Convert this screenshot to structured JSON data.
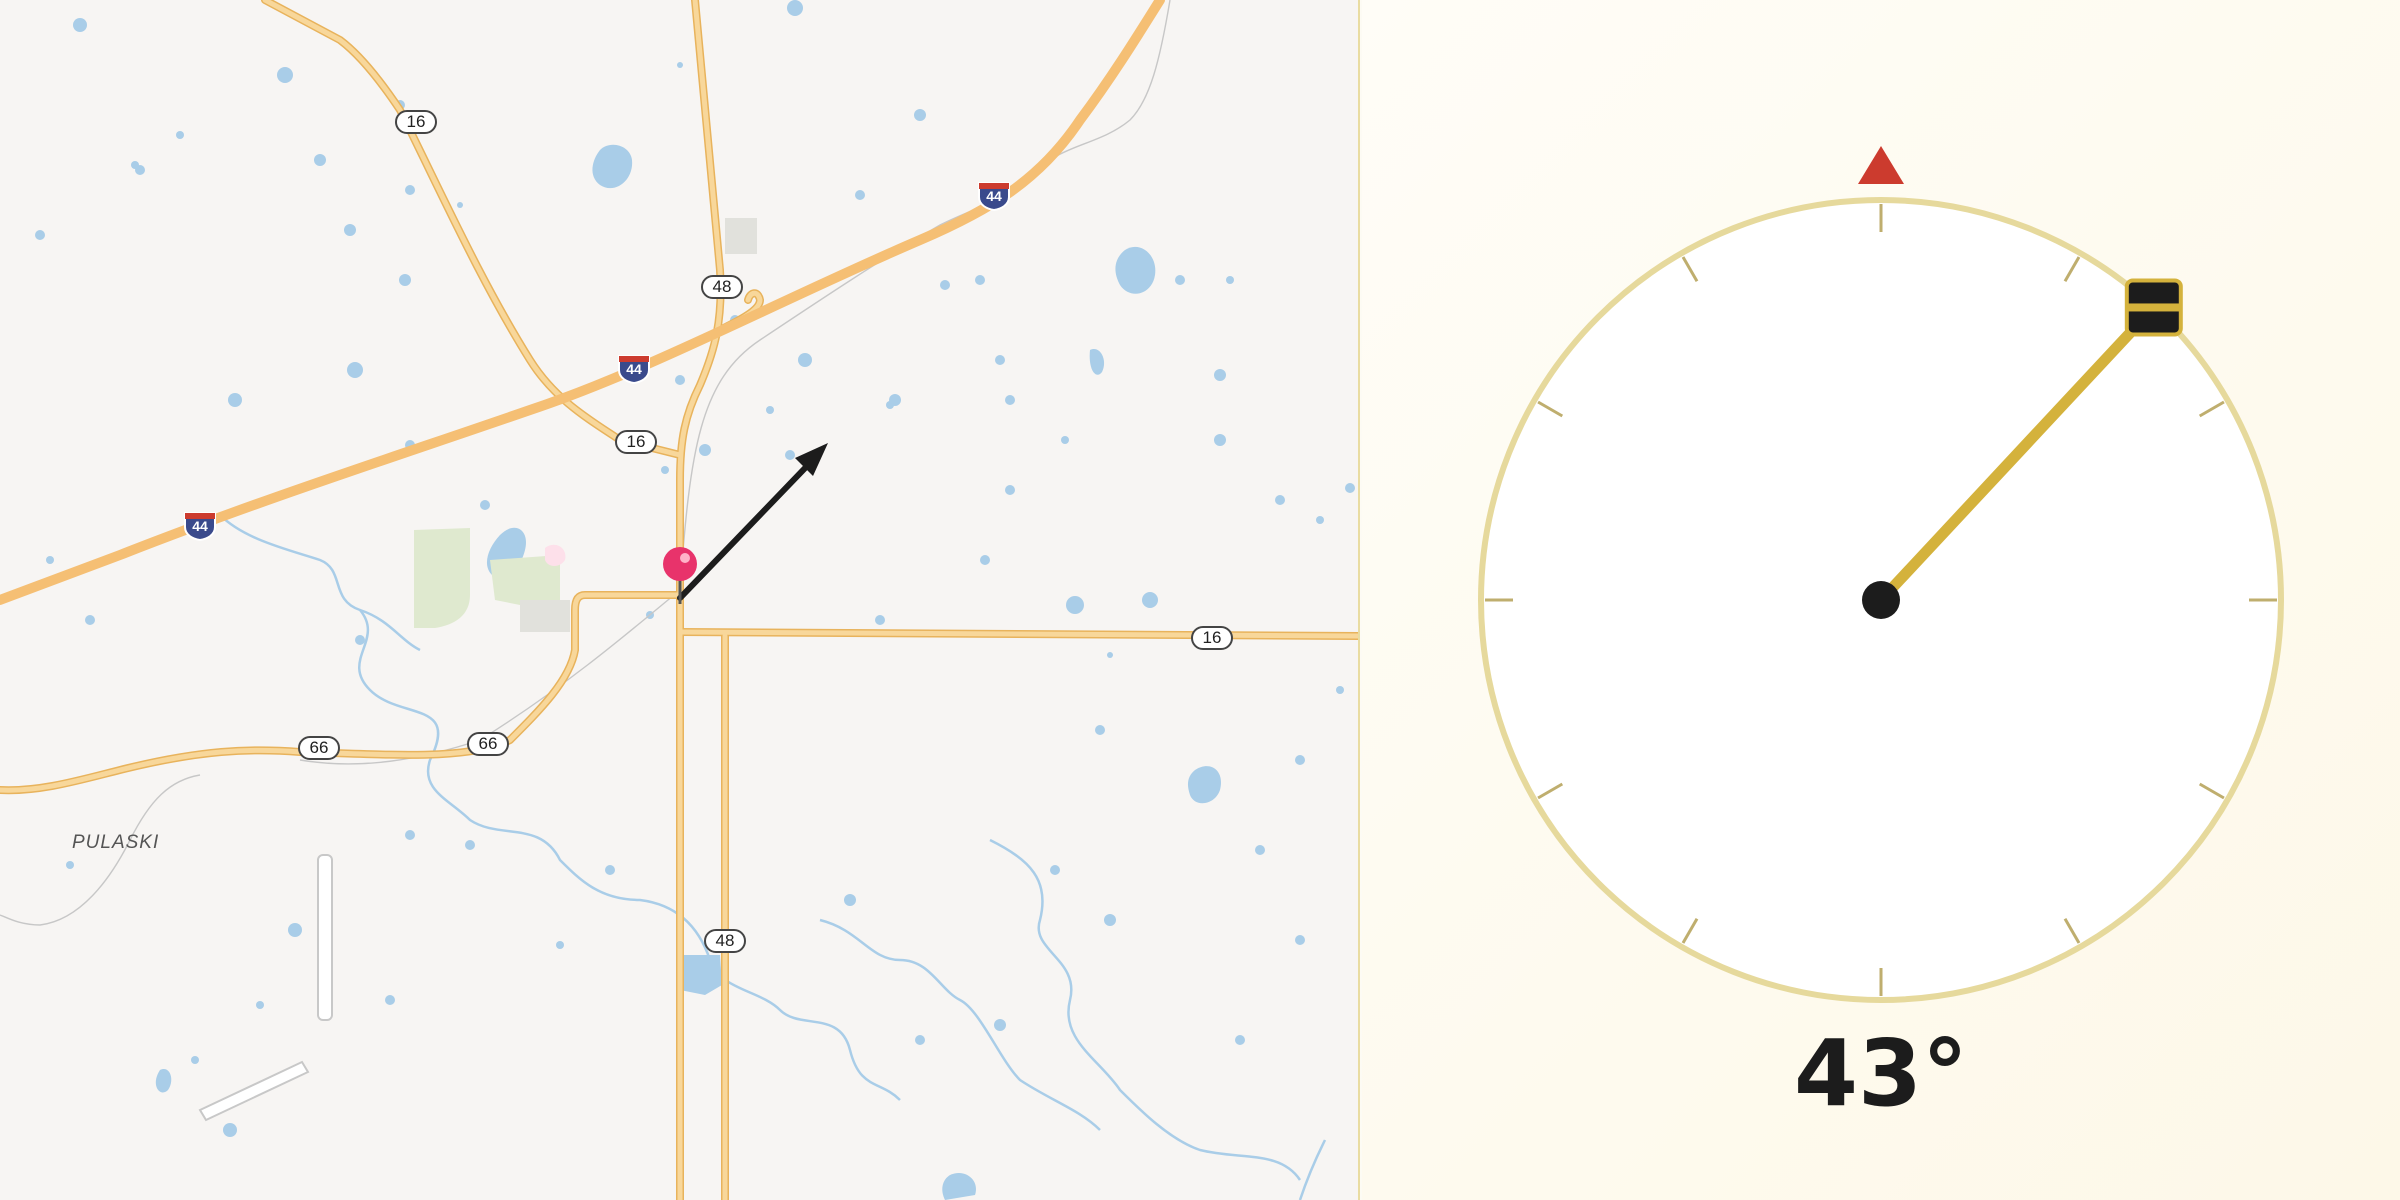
{
  "map": {
    "route_shields": [
      {
        "kind": "state",
        "label": "16"
      },
      {
        "kind": "state",
        "label": "48"
      },
      {
        "kind": "state",
        "label": "16"
      },
      {
        "kind": "state",
        "label": "16"
      },
      {
        "kind": "state",
        "label": "66"
      },
      {
        "kind": "state",
        "label": "66"
      },
      {
        "kind": "state",
        "label": "48"
      },
      {
        "kind": "interstate",
        "label": "44"
      },
      {
        "kind": "interstate",
        "label": "44"
      },
      {
        "kind": "interstate",
        "label": "44"
      }
    ],
    "place_label": "PULASKI",
    "marker": {
      "icon": "map-pin-icon",
      "color": "#e8336b"
    },
    "direction_arrow": {
      "icon": "heading-arrow-icon",
      "color": "#1c1c1c"
    },
    "colors": {
      "land": "#f7f5f3",
      "water": "#a9cde8",
      "road": "#f6c879",
      "park": "#dfe9cf"
    }
  },
  "compass": {
    "heading_degrees": 43,
    "heading_text": "43°",
    "north_indicator": {
      "icon": "north-triangle-icon",
      "color": "#cc3b2e"
    },
    "colors": {
      "ring": "#e6d99c",
      "needle": "#d4b23c",
      "ticks": "#bfae6e",
      "hub": "#1c1c1c"
    }
  }
}
